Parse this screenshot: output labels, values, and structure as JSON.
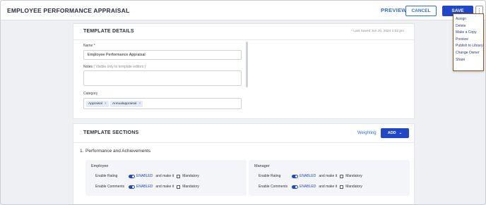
{
  "header": {
    "title": "EMPLOYEE PERFORMANCE APPRAISAL",
    "preview_label": "PREVIEW",
    "cancel_label": "CANCEL",
    "save_label": "SAVE",
    "more_icon": "kebab-icon"
  },
  "menu": {
    "items": [
      "Assign",
      "Delete",
      "Make a Copy",
      "Preview",
      "Publish to Library",
      "Change Owner",
      "Share"
    ]
  },
  "template_details": {
    "title": "TEMPLATE DETAILS",
    "last_saved": "* Last Saved Jun 20, 2024 1:02 pm",
    "name_label": "Name *",
    "name_value": "Employee Performance Appraisal",
    "notes_label": "Notes",
    "notes_hint": "( Visible only to template editors )",
    "notes_value": "",
    "category_label": "Category",
    "categories": [
      "Appraisal",
      "Annualappraisal"
    ],
    "chip_remove": "×"
  },
  "template_sections": {
    "title": "TEMPLATE SECTIONS",
    "weighting_label": "Weighting",
    "add_label": "ADD",
    "section_number": "1.",
    "section_title": "Performance and Achievements",
    "panels": [
      {
        "title": "Employee",
        "rows": [
          {
            "label": "Enable Rating",
            "status": "ENABLED",
            "make": "and make it",
            "mandatory": "Mandatory"
          },
          {
            "label": "Enable Comments",
            "status": "ENABLED",
            "make": "and make it",
            "mandatory": "Mandatory"
          }
        ]
      },
      {
        "title": "Manager",
        "rows": [
          {
            "label": "Enable Rating",
            "status": "ENABLED",
            "make": "and make it",
            "mandatory": "Mandatory"
          },
          {
            "label": "Enable Comments",
            "status": "ENABLED",
            "make": "and make it",
            "mandatory": "Mandatory"
          }
        ]
      }
    ]
  },
  "colors": {
    "primary": "#2147c9",
    "link": "#2f6fd1",
    "menu_border": "#8a5a1c",
    "background": "#eef0f3"
  }
}
